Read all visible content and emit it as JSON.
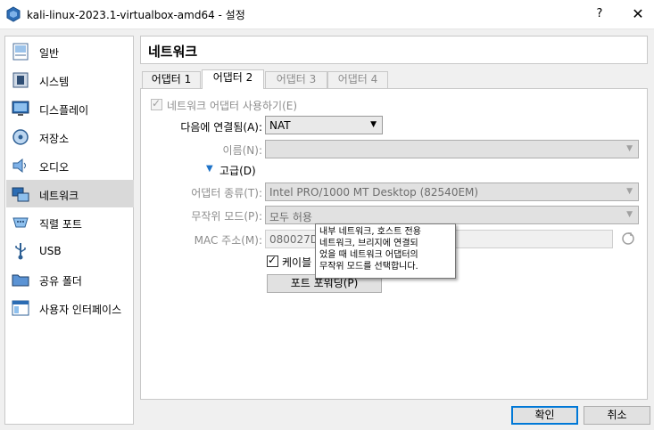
{
  "window": {
    "title": "kali-linux-2023.1-virtualbox-amd64 - 설정",
    "help": "?",
    "close": "✕"
  },
  "sidebar": {
    "items": [
      {
        "label": "일반",
        "icon": "general-icon"
      },
      {
        "label": "시스템",
        "icon": "system-icon"
      },
      {
        "label": "디스플레이",
        "icon": "display-icon"
      },
      {
        "label": "저장소",
        "icon": "storage-icon"
      },
      {
        "label": "오디오",
        "icon": "audio-icon"
      },
      {
        "label": "네트워크",
        "icon": "network-icon",
        "selected": true
      },
      {
        "label": "직렬 포트",
        "icon": "serial-port-icon"
      },
      {
        "label": "USB",
        "icon": "usb-icon"
      },
      {
        "label": "공유 폴더",
        "icon": "shared-folder-icon"
      },
      {
        "label": "사용자 인터페이스",
        "icon": "user-interface-icon"
      }
    ]
  },
  "page": {
    "title": "네트워크"
  },
  "tabs": [
    {
      "label": "어댑터 1",
      "state": "normal"
    },
    {
      "label": "어댑터 2",
      "state": "active"
    },
    {
      "label": "어댑터 3",
      "state": "disabled"
    },
    {
      "label": "어댑터 4",
      "state": "disabled"
    }
  ],
  "form": {
    "enable_adapter": "네트워크 어댑터 사용하기(E)",
    "attached_label": "다음에 연결됨(A):",
    "attached_value": "NAT",
    "name_label": "이름(N):",
    "name_value": "",
    "advanced_label": "고급(D)",
    "adapter_type_label": "어댑터 종류(T):",
    "adapter_type_value": "Intel PRO/1000 MT Desktop (82540EM)",
    "promiscuous_label": "무작위 모드(P):",
    "promiscuous_value": "모두 허용",
    "mac_label": "MAC 주소(M):",
    "mac_value": "080027DF",
    "cable_label": "케이블",
    "port_forwarding": "포트 포워딩(P)"
  },
  "tooltip": {
    "lines": [
      "내부 네트워크, 호스트 전용",
      "네트워크, 브리지에 연결되",
      "었을 때 네트워크 어댑터의",
      "무작위 모드를 선택합니다."
    ]
  },
  "buttons": {
    "ok": "확인",
    "cancel": "취소"
  }
}
